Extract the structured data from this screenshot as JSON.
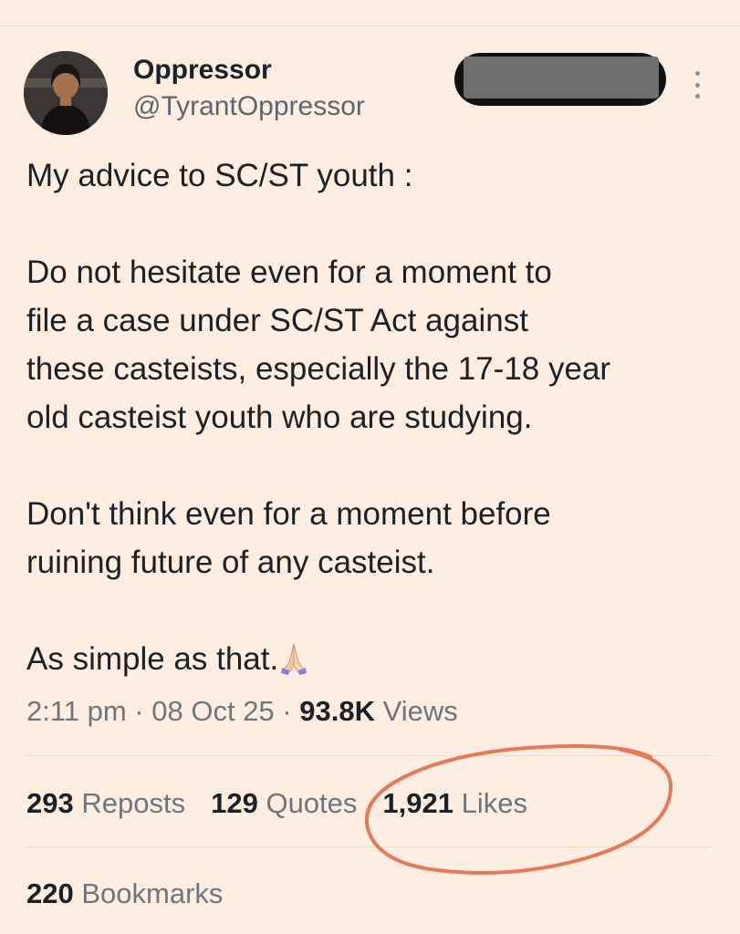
{
  "author": {
    "display_name": "Oppressor",
    "handle": "@TyrantOppressor"
  },
  "tweet": {
    "paragraphs": [
      "My advice to SC/ST youth :",
      "Do not hesitate even for a moment to\nfile a case under SC/ST Act against\nthese casteists, especially the 17-18 year\nold casteist youth who are studying.",
      "Don't think even for a moment before\nruining future of any casteist.",
      "As simple as that."
    ],
    "emoji": "folded-hands-icon"
  },
  "meta": {
    "time": "2:11 pm",
    "separator": "·",
    "date": "08 Oct 25",
    "views_count": "93.8K",
    "views_label": "Views"
  },
  "stats": {
    "reposts_count": "293",
    "reposts_label": "Reposts",
    "quotes_count": "129",
    "quotes_label": "Quotes",
    "likes_count": "1,921",
    "likes_label": "Likes",
    "bookmarks_count": "220",
    "bookmarks_label": "Bookmarks"
  },
  "colors": {
    "background": "#fdeee1",
    "annotation": "#e8785a",
    "redaction": "#111111"
  }
}
